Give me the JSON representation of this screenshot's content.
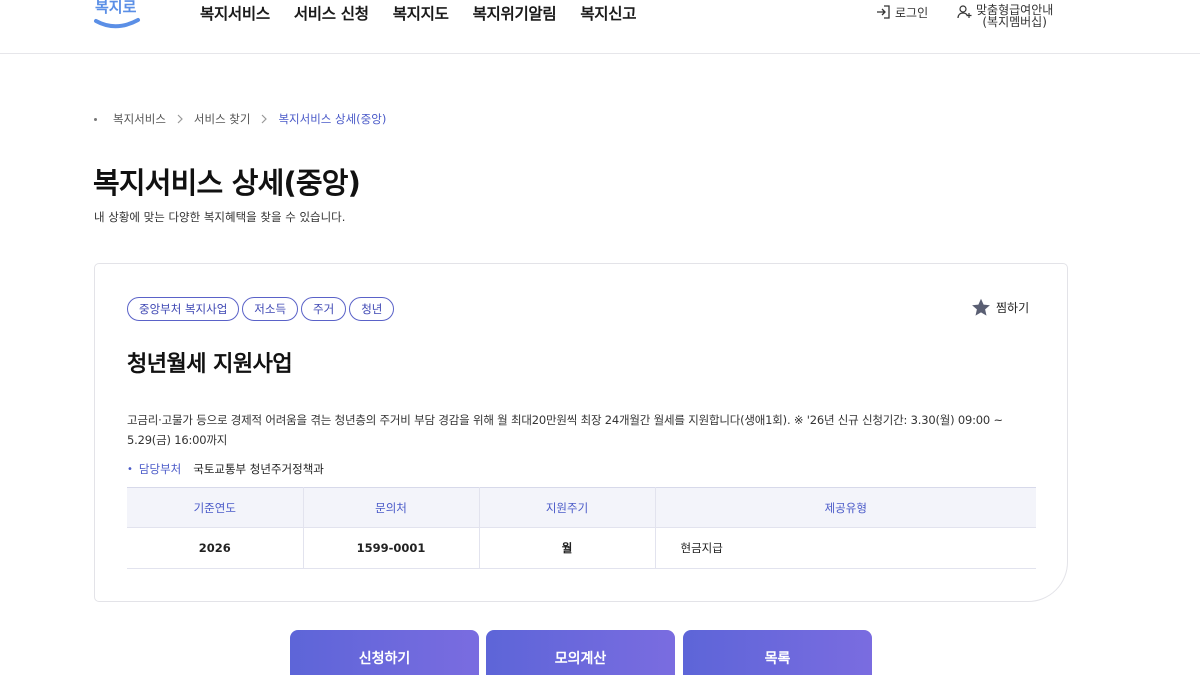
{
  "header": {
    "logo_text": "복지로",
    "nav": [
      "복지서비스",
      "서비스 신청",
      "복지지도",
      "복지위기알림",
      "복지신고"
    ],
    "login_label": "로그인",
    "member_line1": "맞춤형급여안내",
    "member_line2": "(복지멤버십)"
  },
  "breadcrumb": [
    "복지서비스",
    "서비스 찾기",
    "복지서비스 상세(중앙)"
  ],
  "page": {
    "title": "복지서비스 상세(중앙)",
    "description": "내 상황에 맞는 다양한 복지혜택을 찾을 수 있습니다."
  },
  "service": {
    "tags": [
      "중앙부처 복지사업",
      "저소득",
      "주거",
      "청년"
    ],
    "bookmark_label": "찜하기",
    "title": "청년월세 지원사업",
    "description": "고금리·고물가 등으로 경제적 어려움을 겪는 청년층의 주거비 부담 경감을 위해 월 최대20만원씩 최장 24개월간 월세를 지원합니다(생애1회). ※ '26년 신규 신청기간: 3.30(월) 09:00 ~ 5.29(금) 16:00까지",
    "dept_label": "담당부처",
    "dept_value": "국토교통부 청년주거정책과",
    "table": {
      "headers": [
        "기준연도",
        "문의처",
        "지원주기",
        "제공유형"
      ],
      "row": [
        "2026",
        "1599-0001",
        "월",
        "현금지급"
      ]
    }
  },
  "buttons": {
    "apply": "신청하기",
    "calc": "모의계산",
    "list": "목록"
  },
  "colors": {
    "accent": "#4a5ac8",
    "button_gradient_start": "#5d65d8",
    "button_gradient_end": "#7a6ce0"
  }
}
